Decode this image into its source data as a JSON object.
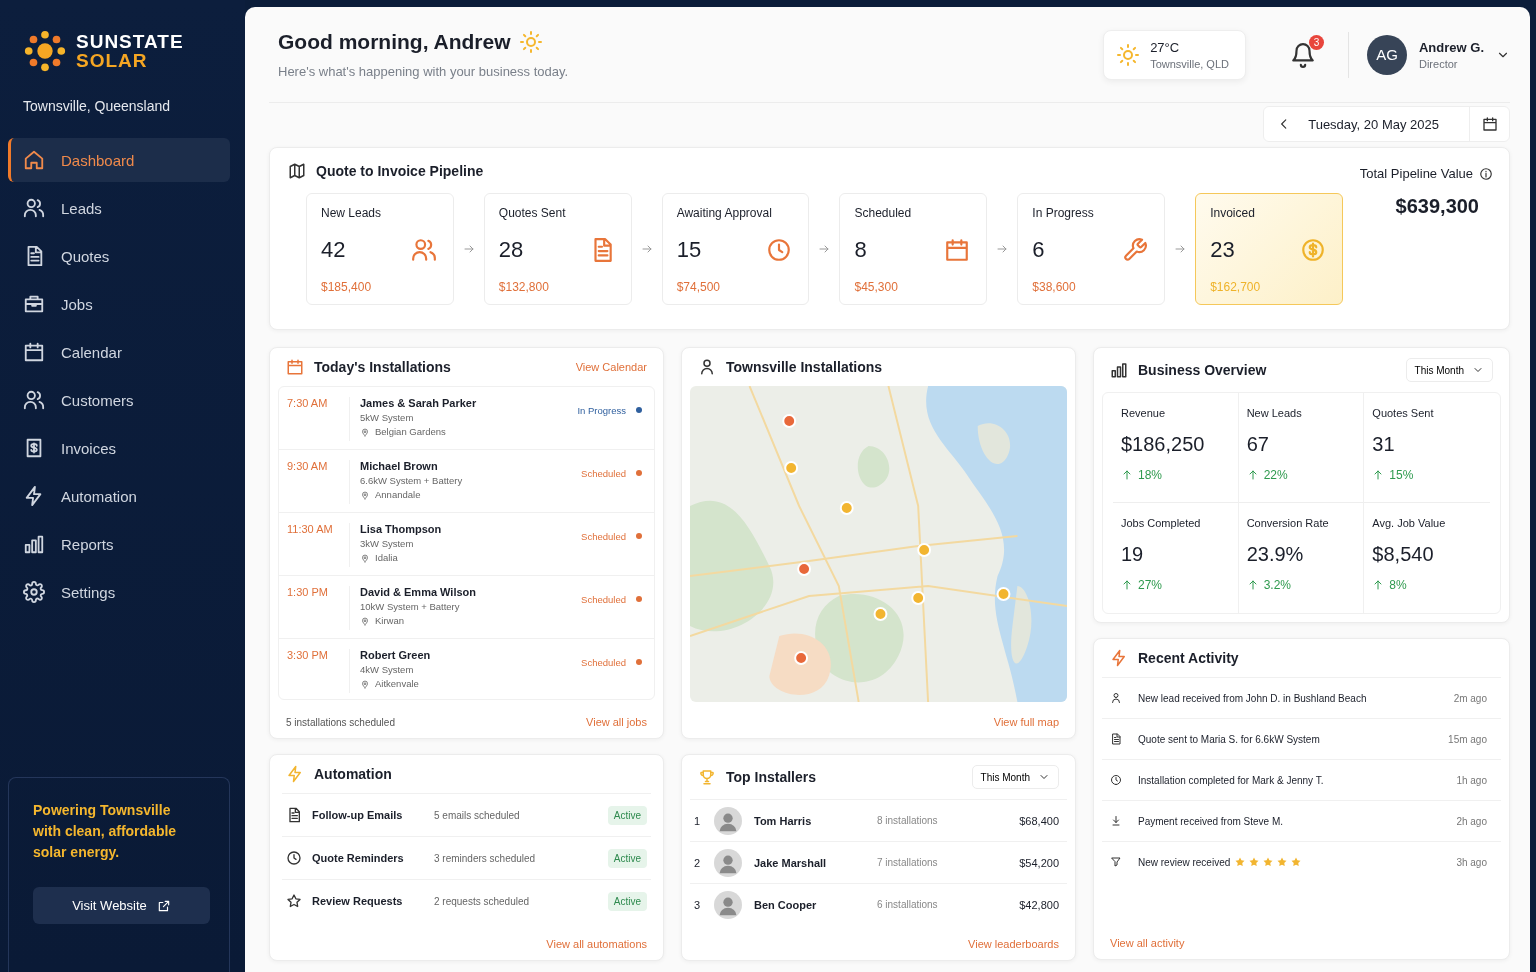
{
  "sidebar": {
    "brand": {
      "line1": "SUNSTATE",
      "line2": "SOLAR"
    },
    "location": "Townsville, Queensland",
    "items": [
      {
        "label": "Dashboard",
        "selected": true
      },
      {
        "label": "Leads",
        "selected": false
      },
      {
        "label": "Quotes",
        "selected": false
      },
      {
        "label": "Jobs",
        "selected": false
      },
      {
        "label": "Calendar",
        "selected": false
      },
      {
        "label": "Customers",
        "selected": false
      },
      {
        "label": "Invoices",
        "selected": false
      },
      {
        "label": "Automation",
        "selected": false
      },
      {
        "label": "Reports",
        "selected": false
      },
      {
        "label": "Settings",
        "selected": false
      }
    ],
    "promo": {
      "text": "Powering Townsville with clean, affordable solar energy.",
      "button": "Visit Website"
    }
  },
  "header": {
    "greeting": "Good morning, Andrew",
    "subtitle": "Here's what's happening with your business today.",
    "weather": {
      "temp": "27°C",
      "place": "Townsville, QLD"
    },
    "notifications": "3",
    "user": {
      "initials": "AG",
      "name": "Andrew G.",
      "role": "Director"
    },
    "date": "Tuesday, 20 May 2025"
  },
  "pipeline": {
    "title": "Quote to Invoice Pipeline",
    "total_label": "Total Pipeline Value",
    "total_value": "$639,300",
    "stages": [
      {
        "label": "New Leads",
        "count": "42",
        "value": "$185,400",
        "highlighted": false
      },
      {
        "label": "Quotes Sent",
        "count": "28",
        "value": "$132,800",
        "highlighted": false
      },
      {
        "label": "Awaiting Approval",
        "count": "15",
        "value": "$74,500",
        "highlighted": false
      },
      {
        "label": "Scheduled",
        "count": "8",
        "value": "$45,300",
        "highlighted": false
      },
      {
        "label": "In Progress",
        "count": "6",
        "value": "$38,600",
        "highlighted": false
      },
      {
        "label": "Invoiced",
        "count": "23",
        "value": "$162,700",
        "highlighted": true
      }
    ]
  },
  "installations": {
    "title": "Today's Installations",
    "link": "View Calendar",
    "rows": [
      {
        "time": "7:30 AM",
        "name": "James & Sarah Parker",
        "system": "5kW System",
        "location": "Belgian Gardens",
        "status": "In Progress",
        "color": "#2f5f9e"
      },
      {
        "time": "9:30 AM",
        "name": "Michael Brown",
        "system": "6.6kW System + Battery",
        "location": "Annandale",
        "status": "Scheduled",
        "color": "#e0703a"
      },
      {
        "time": "11:30 AM",
        "name": "Lisa Thompson",
        "system": "3kW System",
        "location": "Idalia",
        "status": "Scheduled",
        "color": "#e0703a"
      },
      {
        "time": "1:30 PM",
        "name": "David & Emma Wilson",
        "system": "10kW System + Battery",
        "location": "Kirwan",
        "status": "Scheduled",
        "color": "#e0703a"
      },
      {
        "time": "3:30 PM",
        "name": "Robert Green",
        "system": "4kW System",
        "location": "Aitkenvale",
        "status": "Scheduled",
        "color": "#e0703a"
      }
    ],
    "footer": "5 installations scheduled",
    "footer_link": "View all jobs"
  },
  "map": {
    "title": "Townsville Installations",
    "link": "View full map"
  },
  "overview": {
    "title": "Business Overview",
    "period": "This Month",
    "metrics": [
      {
        "label": "Revenue",
        "value": "$186,250",
        "change": "18%"
      },
      {
        "label": "New Leads",
        "value": "67",
        "change": "22%"
      },
      {
        "label": "Quotes Sent",
        "value": "31",
        "change": "15%"
      },
      {
        "label": "Jobs Completed",
        "value": "19",
        "change": "27%"
      },
      {
        "label": "Conversion Rate",
        "value": "23.9%",
        "change": "3.2%"
      },
      {
        "label": "Avg. Job Value",
        "value": "$8,540",
        "change": "8%"
      }
    ]
  },
  "activity": {
    "title": "Recent Activity",
    "link": "View all activity",
    "items": [
      {
        "text": "New lead received from John D. in Bushland Beach",
        "time": "2m ago"
      },
      {
        "text": "Quote sent to Maria S. for 6.6kW System",
        "time": "15m ago"
      },
      {
        "text": "Installation completed for Mark & Jenny T.",
        "time": "1h ago"
      },
      {
        "text": "Payment received from Steve M.",
        "time": "2h ago"
      },
      {
        "text": "New review received",
        "time": "3h ago",
        "stars": 5
      }
    ]
  },
  "automation": {
    "title": "Automation",
    "link": "View all automations",
    "items": [
      {
        "name": "Follow-up Emails",
        "detail": "5 emails scheduled",
        "status": "Active"
      },
      {
        "name": "Quote Reminders",
        "detail": "3 reminders scheduled",
        "status": "Active"
      },
      {
        "name": "Review Requests",
        "detail": "2 requests scheduled",
        "status": "Active"
      }
    ]
  },
  "installers": {
    "title": "Top Installers",
    "period": "This Month",
    "link": "View leaderboards",
    "rows": [
      {
        "rank": "1",
        "name": "Tom Harris",
        "count": "8 installations",
        "amount": "$68,400"
      },
      {
        "rank": "2",
        "name": "Jake Marshall",
        "count": "7 installations",
        "amount": "$54,200"
      },
      {
        "rank": "3",
        "name": "Ben Cooper",
        "count": "6 installations",
        "amount": "$42,800"
      }
    ]
  }
}
